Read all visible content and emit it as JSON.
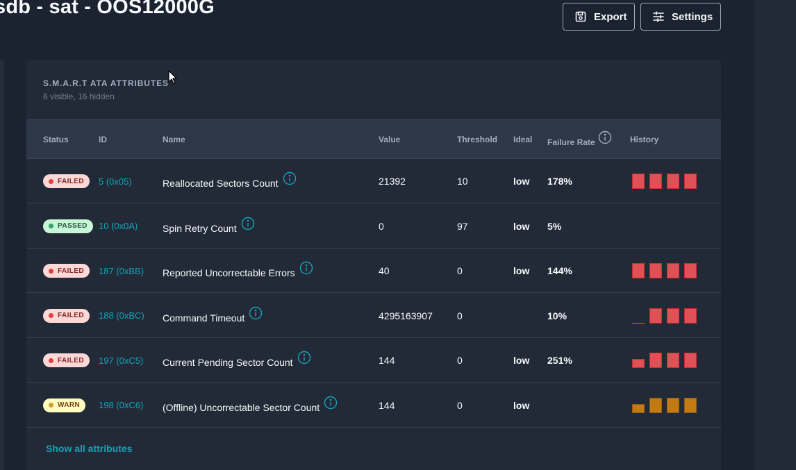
{
  "header": {
    "title": "sdb - sat - OOS12000G",
    "export_label": "Export",
    "settings_label": "Settings"
  },
  "card": {
    "title": "S.M.A.R.T ATA Attributes",
    "subtitle": "6 visible, 16 hidden",
    "show_all_label": "Show all attributes"
  },
  "table": {
    "columns": {
      "status": "Status",
      "id": "ID",
      "name": "Name",
      "value": "Value",
      "threshold": "Threshold",
      "ideal": "Ideal",
      "failure_rate": "Failure Rate",
      "history": "History"
    },
    "rows": [
      {
        "status": "FAILED",
        "status_kind": "failed",
        "id": "5 (0x05)",
        "name": "Reallocated Sectors Count",
        "value": "21392",
        "threshold": "10",
        "ideal": "low",
        "failure_rate": "178%",
        "history": [
          {
            "level": 1.0,
            "color": "red"
          },
          {
            "level": 1.0,
            "color": "red"
          },
          {
            "level": 1.0,
            "color": "red"
          },
          {
            "level": 1.0,
            "color": "red"
          }
        ]
      },
      {
        "status": "PASSED",
        "status_kind": "passed",
        "id": "10 (0x0A)",
        "name": "Spin Retry Count",
        "value": "0",
        "threshold": "97",
        "ideal": "low",
        "failure_rate": "5%",
        "history": []
      },
      {
        "status": "FAILED",
        "status_kind": "failed",
        "id": "187 (0xBB)",
        "name": "Reported Uncorrectable Errors",
        "value": "40",
        "threshold": "0",
        "ideal": "low",
        "failure_rate": "144%",
        "history": [
          {
            "level": 1.0,
            "color": "red"
          },
          {
            "level": 1.0,
            "color": "red"
          },
          {
            "level": 1.0,
            "color": "red"
          },
          {
            "level": 1.0,
            "color": "red"
          }
        ]
      },
      {
        "status": "FAILED",
        "status_kind": "failed",
        "id": "188 (0xBC)",
        "name": "Command Timeout",
        "value": "4295163907",
        "threshold": "0",
        "ideal": "",
        "failure_rate": "10%",
        "history": [
          {
            "level": 0.05,
            "color": "orange"
          },
          {
            "level": 1.0,
            "color": "red"
          },
          {
            "level": 1.0,
            "color": "red"
          },
          {
            "level": 1.0,
            "color": "red"
          }
        ]
      },
      {
        "status": "FAILED",
        "status_kind": "failed",
        "id": "197 (0xC5)",
        "name": "Current Pending Sector Count",
        "value": "144",
        "threshold": "0",
        "ideal": "low",
        "failure_rate": "251%",
        "history": [
          {
            "level": 0.6,
            "color": "red"
          },
          {
            "level": 1.0,
            "color": "red"
          },
          {
            "level": 1.0,
            "color": "red"
          },
          {
            "level": 1.0,
            "color": "red"
          }
        ]
      },
      {
        "status": "WARN",
        "status_kind": "warn",
        "id": "198 (0xC6)",
        "name": "(Offline) Uncorrectable Sector Count",
        "value": "144",
        "threshold": "0",
        "ideal": "low",
        "failure_rate": "",
        "history": [
          {
            "level": 0.6,
            "color": "orange"
          },
          {
            "level": 1.0,
            "color": "orange"
          },
          {
            "level": 1.0,
            "color": "orange"
          },
          {
            "level": 1.0,
            "color": "orange"
          }
        ]
      }
    ]
  },
  "colors": {
    "accent": "#14a3b8",
    "failed_bar": "#e05157",
    "warn_bar": "#c27a12"
  },
  "icons": {
    "export": "save-icon",
    "settings": "sliders-icon",
    "info": "info-icon",
    "cursor": "mouse-pointer-icon"
  }
}
